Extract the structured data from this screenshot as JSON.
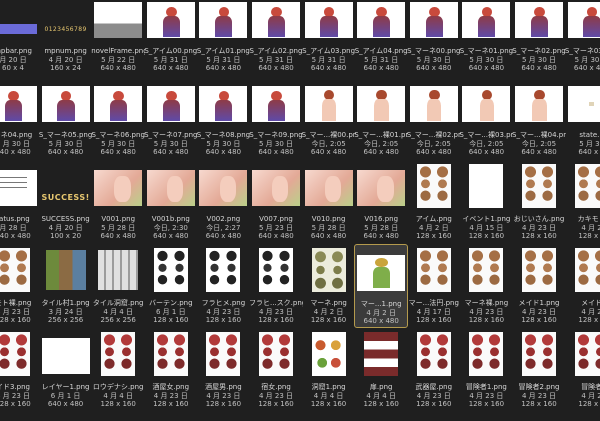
{
  "files": [
    {
      "name": "mpbar.png",
      "date": "月 20 日",
      "size": "60 x 4",
      "col": 0,
      "row": 0,
      "art": "bar"
    },
    {
      "name": "mpnum.png",
      "date": "4 月 20 日",
      "size": "160 x 24",
      "col": 1,
      "row": 0,
      "art": "nums",
      "text": "0123456789"
    },
    {
      "name": "novelFrame.png",
      "date": "5 月 22 日",
      "size": "640 x 480",
      "col": 2,
      "row": 0,
      "art": "gray"
    },
    {
      "name": "S_アイム00.png",
      "date": "5 月 31 日",
      "size": "640 x 480",
      "col": 3,
      "row": 0,
      "art": "girl"
    },
    {
      "name": "S_アイム01.png",
      "date": "5 月 31 日",
      "size": "640 x 480",
      "col": 4,
      "row": 0,
      "art": "girl"
    },
    {
      "name": "S_アイム02.png",
      "date": "5 月 31 日",
      "size": "640 x 480",
      "col": 5,
      "row": 0,
      "art": "girl"
    },
    {
      "name": "S_アイム03.png",
      "date": "5 月 31 日",
      "size": "640 x 480",
      "col": 6,
      "row": 0,
      "art": "girl"
    },
    {
      "name": "S_アイム04.png",
      "date": "5 月 31 日",
      "size": "640 x 480",
      "col": 7,
      "row": 0,
      "art": "girl"
    },
    {
      "name": "S_マーネ00.png",
      "date": "5 月 30 日",
      "size": "640 x 480",
      "col": 8,
      "row": 0,
      "art": "girl"
    },
    {
      "name": "S_マーネ01.png",
      "date": "5 月 30 日",
      "size": "640 x 480",
      "col": 9,
      "row": 0,
      "art": "girl"
    },
    {
      "name": "S_マーネ02.png",
      "date": "5 月 30 日",
      "size": "640 x 480",
      "col": 10,
      "row": 0,
      "art": "girl"
    },
    {
      "name": "S_マーネ03.png",
      "date": "5 月 30 日",
      "size": "640 x 480",
      "col": 11,
      "row": 0,
      "art": "girl"
    },
    {
      "name": "ーネ04.png",
      "date": "5 月 30 日",
      "size": "640 x 480",
      "col": 0,
      "row": 1,
      "art": "girl"
    },
    {
      "name": "S_マーネ05.png",
      "date": "5 月 30 日",
      "size": "640 x 480",
      "col": 1,
      "row": 1,
      "art": "girl"
    },
    {
      "name": "S_マーネ06.png",
      "date": "5 月 30 日",
      "size": "640 x 480",
      "col": 2,
      "row": 1,
      "art": "girl"
    },
    {
      "name": "S_マーネ07.png",
      "date": "5 月 30 日",
      "size": "640 x 480",
      "col": 3,
      "row": 1,
      "art": "girl"
    },
    {
      "name": "S_マーネ08.png",
      "date": "5 月 30 日",
      "size": "640 x 480",
      "col": 4,
      "row": 1,
      "art": "girl"
    },
    {
      "name": "S_マーネ09.png",
      "date": "5 月 30 日",
      "size": "640 x 480",
      "col": 5,
      "row": 1,
      "art": "girl"
    },
    {
      "name": "S_マー...裸00.png",
      "date": "今日, 2:05",
      "size": "640 x 480",
      "col": 6,
      "row": 1,
      "art": "nude"
    },
    {
      "name": "S_マー...裸01.png",
      "date": "今日, 2:05",
      "size": "640 x 480",
      "col": 7,
      "row": 1,
      "art": "nude"
    },
    {
      "name": "S_マー...裸02.png",
      "date": "今日, 2:05",
      "size": "640 x 480",
      "col": 8,
      "row": 1,
      "art": "nude"
    },
    {
      "name": "S_マー...裸03.png",
      "date": "今日, 2:05",
      "size": "640 x 480",
      "col": 9,
      "row": 1,
      "art": "nude"
    },
    {
      "name": "S_マー...裸04.png",
      "date": "今日, 2:05",
      "size": "640 x 480",
      "col": 10,
      "row": 1,
      "art": "nude"
    },
    {
      "name": "state.p",
      "date": "5 月 31",
      "size": "640 x 4",
      "col": 11,
      "row": 1,
      "art": "small"
    },
    {
      "name": "tatus.png",
      "date": "月 28 日",
      "size": "640 x 480",
      "col": 0,
      "row": 2,
      "art": "text"
    },
    {
      "name": "SUCCESS.png",
      "date": "4 月 20 日",
      "size": "100 x 20",
      "col": 1,
      "row": 2,
      "art": "success",
      "text": "SUCCESS!"
    },
    {
      "name": "V001.png",
      "date": "5 月 28 日",
      "size": "640 x 480",
      "col": 2,
      "row": 2,
      "art": "scene"
    },
    {
      "name": "V001b.png",
      "date": "今日, 2:30",
      "size": "640 x 480",
      "col": 3,
      "row": 2,
      "art": "scene"
    },
    {
      "name": "V002.png",
      "date": "今日, 2:27",
      "size": "640 x 480",
      "col": 4,
      "row": 2,
      "art": "scene"
    },
    {
      "name": "V007.png",
      "date": "5 月 23 日",
      "size": "640 x 480",
      "col": 5,
      "row": 2,
      "art": "scene"
    },
    {
      "name": "V010.png",
      "date": "5 月 28 日",
      "size": "640 x 480",
      "col": 6,
      "row": 2,
      "art": "scene"
    },
    {
      "name": "V016.png",
      "date": "5 月 28 日",
      "size": "640 x 480",
      "col": 7,
      "row": 2,
      "art": "scene"
    },
    {
      "name": "アイム.png",
      "date": "4 月 2 日",
      "size": "128 x 160",
      "col": 8,
      "row": 2,
      "art": "sprites"
    },
    {
      "name": "イベント1.png",
      "date": "4 月 15 日",
      "size": "128 x 160",
      "col": 9,
      "row": 2,
      "art": "white"
    },
    {
      "name": "おじいさん.png",
      "date": "4 月 23 日",
      "size": "128 x 160",
      "col": 10,
      "row": 2,
      "art": "sprites"
    },
    {
      "name": "カキモト",
      "date": "4 月 2",
      "size": "128 x 1",
      "col": 11,
      "row": 2,
      "art": "sprites"
    },
    {
      "name": "モト裸.png",
      "date": "4 月 23 日",
      "size": "128 x 160",
      "col": 0,
      "row": 3,
      "art": "sprites"
    },
    {
      "name": "タイル村1.png",
      "date": "3 月 24 日",
      "size": "256 x 256",
      "col": 1,
      "row": 3,
      "art": "tiles"
    },
    {
      "name": "タイル洞窟.png",
      "date": "4 月 4 日",
      "size": "256 x 256",
      "col": 2,
      "row": 3,
      "art": "tiles2"
    },
    {
      "name": "バーテン.png",
      "date": "6 月 1 日",
      "size": "128 x 160",
      "col": 3,
      "row": 3,
      "art": "sprites-bw"
    },
    {
      "name": "フラヒメ.png",
      "date": "4 月 23 日",
      "size": "128 x 160",
      "col": 4,
      "row": 3,
      "art": "sprites-bw"
    },
    {
      "name": "フラヒ...スク.png",
      "date": "4 月 23 日",
      "size": "128 x 160",
      "col": 5,
      "row": 3,
      "art": "sprites-bw"
    },
    {
      "name": "マーネ.png",
      "date": "4 月 2 日",
      "size": "128 x 160",
      "col": 6,
      "row": 3,
      "art": "sprites-gr"
    },
    {
      "name": "マー...1.png",
      "date": "4 月 2 日",
      "size": "640 x 480",
      "col": 7,
      "row": 3,
      "art": "selgirl",
      "selected": true
    },
    {
      "name": "マー...法円.png",
      "date": "4 月 17 日",
      "size": "128 x 160",
      "col": 8,
      "row": 3,
      "art": "sprites"
    },
    {
      "name": "マーネ裸.png",
      "date": "4 月 23 日",
      "size": "128 x 160",
      "col": 9,
      "row": 3,
      "art": "sprites"
    },
    {
      "name": "メイド1.png",
      "date": "4 月 23 日",
      "size": "128 x 160",
      "col": 10,
      "row": 3,
      "art": "sprites"
    },
    {
      "name": "メイド",
      "date": "4 月 2",
      "size": "128 x 1",
      "col": 11,
      "row": 3,
      "art": "sprites"
    },
    {
      "name": "イド3.png",
      "date": "4 月 23 日",
      "size": "128 x 160",
      "col": 0,
      "row": 4,
      "art": "sprites-red"
    },
    {
      "name": "レイヤー1.png",
      "date": "6 月 1 日",
      "size": "640 x 480",
      "col": 1,
      "row": 4,
      "art": "white"
    },
    {
      "name": "ロウデナシ.png",
      "date": "4 月 4 日",
      "size": "128 x 160",
      "col": 2,
      "row": 4,
      "art": "sprites-red"
    },
    {
      "name": "酒屋女.png",
      "date": "4 月 23 日",
      "size": "128 x 160",
      "col": 3,
      "row": 4,
      "art": "sprites-red"
    },
    {
      "name": "酒屋男.png",
      "date": "4 月 23 日",
      "size": "128 x 160",
      "col": 4,
      "row": 4,
      "art": "sprites-red"
    },
    {
      "name": "宿女.png",
      "date": "4 月 23 日",
      "size": "128 x 160",
      "col": 5,
      "row": 4,
      "art": "sprites-red"
    },
    {
      "name": "洞窟1.png",
      "date": "4 月 4 日",
      "size": "128 x 160",
      "col": 6,
      "row": 4,
      "art": "mushroom"
    },
    {
      "name": "扉.png",
      "date": "4 月 4 日",
      "size": "128 x 160",
      "col": 7,
      "row": 4,
      "art": "cards"
    },
    {
      "name": "武器屋.png",
      "date": "4 月 23 日",
      "size": "128 x 160",
      "col": 8,
      "row": 4,
      "art": "sprites-red"
    },
    {
      "name": "冒険者1.png",
      "date": "4 月 23 日",
      "size": "128 x 160",
      "col": 9,
      "row": 4,
      "art": "sprites-red"
    },
    {
      "name": "冒険者2.png",
      "date": "4 月 23 日",
      "size": "128 x 160",
      "col": 10,
      "row": 4,
      "art": "sprites-red"
    },
    {
      "name": "冒険者",
      "date": "4 月 2",
      "size": "128 x 1",
      "col": 11,
      "row": 4,
      "art": "sprites-red"
    }
  ]
}
